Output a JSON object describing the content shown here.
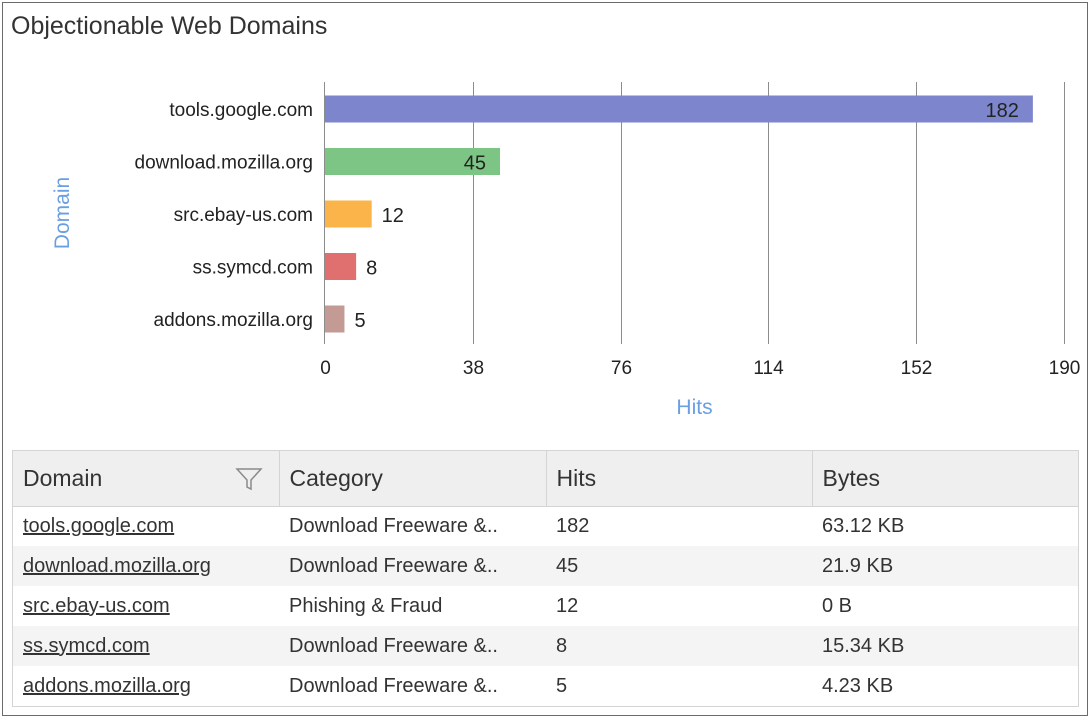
{
  "panel": {
    "title": "Objectionable Web Domains"
  },
  "chart_data": {
    "type": "bar",
    "orientation": "horizontal",
    "title": "Objectionable Web Domains",
    "xlabel": "Hits",
    "ylabel": "Domain",
    "categories": [
      "tools.google.com",
      "download.mozilla.org",
      "src.ebay-us.com",
      "ss.symcd.com",
      "addons.mozilla.org"
    ],
    "values": [
      182,
      45,
      12,
      8,
      5
    ],
    "colors": [
      "#7d86cc",
      "#7dc584",
      "#fbb44a",
      "#e07070",
      "#c39a94"
    ],
    "xlim": [
      0,
      190
    ],
    "xticks": [
      "0",
      "38",
      "76",
      "114",
      "152",
      "190"
    ],
    "grid": "vertical"
  },
  "table": {
    "columns": [
      "Domain",
      "Category",
      "Hits",
      "Bytes"
    ],
    "rows": [
      {
        "domain": "tools.google.com",
        "category": "Download Freeware &..",
        "hits": "182",
        "bytes": "63.12 KB"
      },
      {
        "domain": "download.mozilla.org",
        "category": "Download Freeware &..",
        "hits": "45",
        "bytes": "21.9 KB"
      },
      {
        "domain": "src.ebay-us.com",
        "category": "Phishing & Fraud",
        "hits": "12",
        "bytes": "0 B"
      },
      {
        "domain": "ss.symcd.com",
        "category": "Download Freeware &..",
        "hits": "8",
        "bytes": "15.34 KB"
      },
      {
        "domain": "addons.mozilla.org",
        "category": "Download Freeware &..",
        "hits": "5",
        "bytes": "4.23 KB"
      }
    ],
    "filter_icon": "funnel-icon"
  }
}
